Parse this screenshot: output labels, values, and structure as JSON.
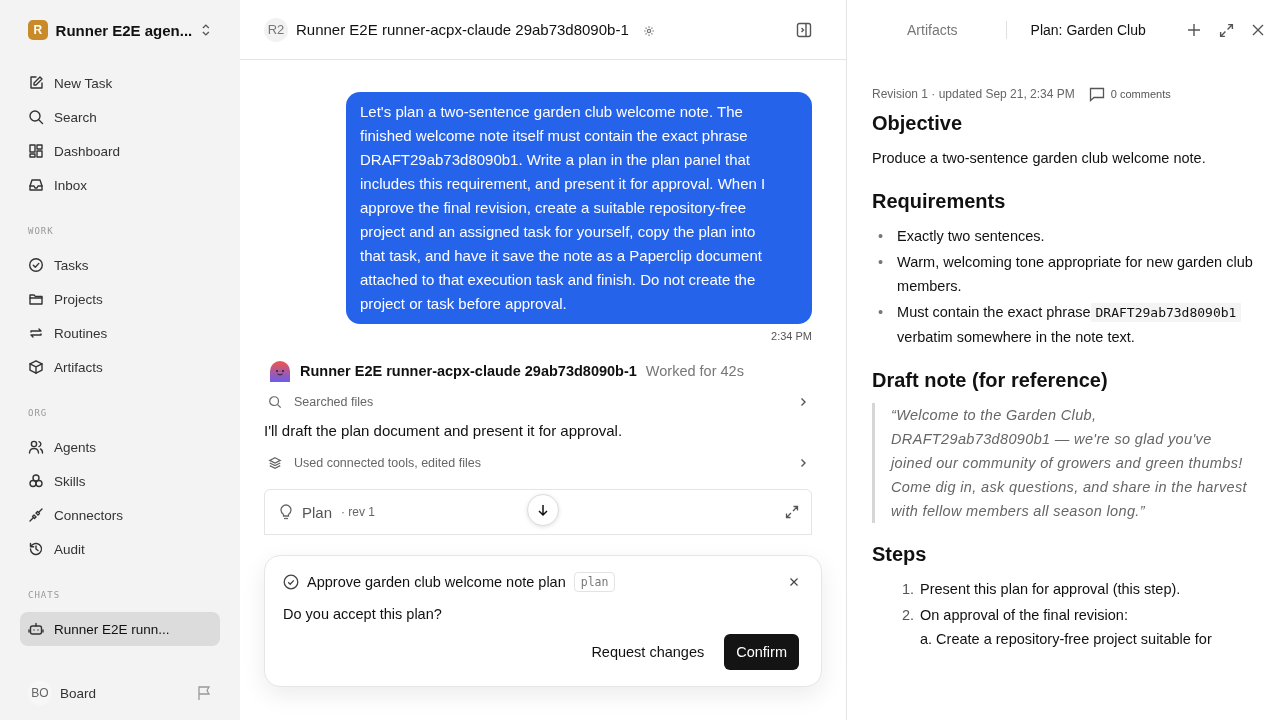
{
  "workspace": {
    "initial": "R",
    "name": "Runner E2E agen..."
  },
  "nav": [
    {
      "label": "New Task",
      "selected": false
    },
    {
      "label": "Search",
      "selected": false
    },
    {
      "label": "Dashboard",
      "selected": false
    },
    {
      "label": "Inbox",
      "selected": false
    }
  ],
  "sections": [
    {
      "title": "WORK",
      "items": [
        {
          "label": "Tasks",
          "selected": false
        },
        {
          "label": "Projects",
          "selected": false
        },
        {
          "label": "Routines",
          "selected": false
        },
        {
          "label": "Artifacts",
          "selected": false
        }
      ]
    },
    {
      "title": "ORG",
      "items": [
        {
          "label": "Agents",
          "selected": false
        },
        {
          "label": "Skills",
          "selected": false
        },
        {
          "label": "Connectors",
          "selected": false
        },
        {
          "label": "Audit",
          "selected": false
        }
      ]
    },
    {
      "title": "CHATS",
      "items": [
        {
          "label": "Runner E2E runn...",
          "selected": true
        }
      ]
    }
  ],
  "user": {
    "initials": "BO",
    "name": "Board"
  },
  "chat": {
    "badge": "R2",
    "title": "Runner E2E runner-acpx-claude 29ab73d8090b-1",
    "user_message": "Let's plan a two-sentence garden club welcome note. The finished welcome note itself must contain the exact phrase DRAFT29ab73d8090b1. Write a plan in the plan panel that includes this requirement, and present it for approval. When I approve the final revision, create a suitable repository-free project and an assigned task for yourself, copy the plan into that task, and have it save the note as a Paperclip document attached to that execution task and finish. Do not create the project or task before approval.",
    "time": "2:34 PM",
    "agent": {
      "name": "Runner E2E runner-acpx-claude 29ab73d8090b-1",
      "status": "Worked for 42s"
    },
    "steps": [
      {
        "kind": "activity",
        "text": "Searched files"
      },
      {
        "kind": "message",
        "text": "I'll draft the plan document and present it for approval."
      },
      {
        "kind": "activity",
        "text": "Used connected tools, edited files"
      }
    ],
    "plan_card": {
      "title": "Plan",
      "meta": "· rev 1"
    },
    "approval": {
      "title": "Approve garden club welcome note plan",
      "tag": "plan",
      "question": "Do you accept this plan?",
      "buttons": [
        "Request changes",
        "Confirm"
      ]
    }
  },
  "panel": {
    "tabs": [
      {
        "label": "Artifacts",
        "selected": false
      },
      {
        "label": "Plan: Garden Club",
        "selected": true
      }
    ],
    "meta": "Revision 1 · updated Sep 21, 2:34 PM",
    "comments": "0 comments",
    "doc": [
      {
        "kind": "heading",
        "text": "Objective"
      },
      {
        "kind": "paragraph",
        "text": "Produce a two-sentence garden club welcome note."
      },
      {
        "kind": "heading",
        "text": "Requirements"
      },
      {
        "kind": "bullets",
        "items": [
          {
            "marker": "•",
            "text": "Exactly two sentences."
          },
          {
            "marker": "•",
            "text": "Warm, welcoming tone appropriate for new garden club members."
          },
          {
            "marker": "•",
            "text": "Must contain the exact phrase",
            "code": "DRAFT29ab73d8090b1",
            "after": "verbatim somewhere in the note text."
          }
        ]
      },
      {
        "kind": "heading",
        "text": "Draft note (for reference)"
      },
      {
        "kind": "quote",
        "text": "“Welcome to the Garden Club, DRAFT29ab73d8090b1 — we're so glad you've joined our community of growers and green thumbs! Come dig in, ask questions, and share in the harvest with fellow members all season long.”"
      },
      {
        "kind": "heading",
        "text": "Steps"
      },
      {
        "kind": "numbered",
        "items": [
          {
            "number": "1.",
            "text": "Present this plan for approval (this step)."
          },
          {
            "number": "2.",
            "text": "On approval of the final revision:",
            "sub": "a. Create a repository-free project suitable for"
          }
        ]
      }
    ]
  }
}
